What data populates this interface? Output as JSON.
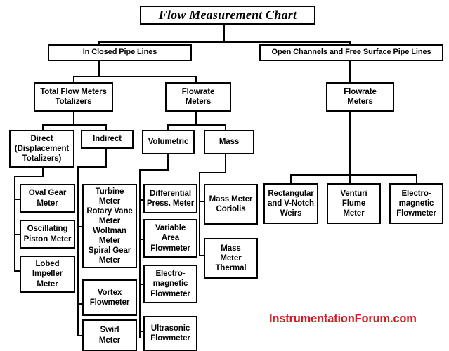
{
  "chart": {
    "type": "tree-diagram",
    "title": "Flow Measurement Chart",
    "watermark": "InstrumentationForum.com",
    "colors": {
      "box_border": "#000000",
      "background": "#ffffff",
      "text": "#000000",
      "watermark": "#cc2026"
    },
    "nodes": {
      "root": "Flow Measurement Chart",
      "closed_pipe": "In Closed Pipe Lines",
      "open_channels": "Open Channels and Free Surface Pipe Lines",
      "total_flow_meters": "Total Flow Meters\nTotalizers",
      "flowrate_meters_closed": "Flowrate\nMeters",
      "flowrate_meters_open": "Flowrate\nMeters",
      "direct": "Direct\n(Displacement\nTotalizers)",
      "indirect": "Indirect",
      "volumetric": "Volumetric",
      "mass": "Mass",
      "oval_gear": "Oval Gear\nMeter",
      "oscillating_piston": "Oscillating\nPiston  Meter",
      "lobed_impeller": "Lobed\nImpeller\nMeter",
      "turbine_group": "Turbine\nMeter\nRotary Vane\nMeter\nWoltman\nMeter\nSpiral Gear\nMeter",
      "vortex": "Vortex\nFlowmeter",
      "swirl": "Swirl\nMeter",
      "differential_pressure": "Differential\nPress. Meter",
      "variable_area": "Variable\nArea\nFlowmeter",
      "electromagnetic_vol": "Electro-\nmagnetic\nFlowmeter",
      "ultrasonic": "Ultrasonic\nFlowmeter",
      "mass_coriolis": "Mass Meter\nCoriolis",
      "mass_thermal": "Mass\nMeter\nThermal",
      "weirs": "Rectangular\nand V-Notch\nWeirs",
      "venturi_flume": "Venturi\nFlume\nMeter",
      "electromagnetic_open": "Electro-\nmagnetic\nFlowmeter"
    }
  }
}
